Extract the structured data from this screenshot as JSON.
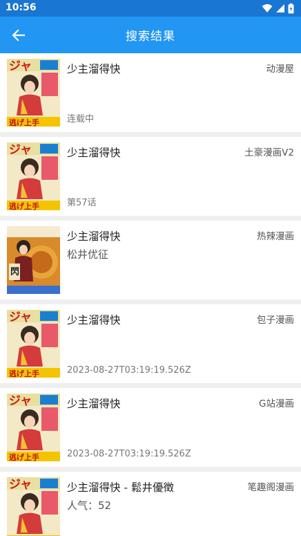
{
  "status_bar": {
    "time": "10:56"
  },
  "app_bar": {
    "title": "搜索结果",
    "back_icon": "arrow-left-icon"
  },
  "results": [
    {
      "title": "少主溜得快",
      "source": "动漫屋",
      "author": "",
      "status": "连载中",
      "cover": "jump-cover"
    },
    {
      "title": "少主溜得快",
      "source": "土豪漫画V2",
      "author": "",
      "status": "第57话",
      "cover": "jump-cover"
    },
    {
      "title": "少主溜得快",
      "source": "热辣漫画",
      "author": "松井优征",
      "status": "",
      "cover": "volume-cover"
    },
    {
      "title": "少主溜得快",
      "source": "包子漫画",
      "author": "",
      "status": "2023-08-27T03:19:19.526Z",
      "cover": "jump-cover"
    },
    {
      "title": "少主溜得快",
      "source": "G站漫画",
      "author": "",
      "status": "2023-08-27T03:19:19.526Z",
      "cover": "jump-cover"
    },
    {
      "title": "少主溜得快 - 鬆井優徵",
      "source": "笔趣阁漫画",
      "author": "人气：52",
      "status": "",
      "cover": "jump-cover"
    }
  ],
  "colors": {
    "primary": "#2196f3",
    "status_bar": "#1976d2",
    "background": "#efefef"
  }
}
